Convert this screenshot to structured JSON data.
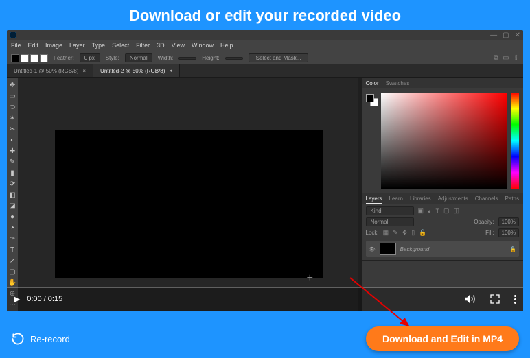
{
  "header": {
    "title": "Download or edit your recorded video"
  },
  "footer": {
    "rerecord_label": "Re-record",
    "download_label": "Download and Edit in MP4"
  },
  "video": {
    "current_time": "0:00",
    "duration": "0:15",
    "time_display": "0:00 / 0:15"
  },
  "ps": {
    "window_controls": [
      "—",
      "▢",
      "✕"
    ],
    "menu": [
      "File",
      "Edit",
      "Image",
      "Layer",
      "Type",
      "Select",
      "Filter",
      "3D",
      "View",
      "Window",
      "Help"
    ],
    "options": {
      "feather_label": "Feather:",
      "feather_value": "0 px",
      "style_label": "Style:",
      "style_value": "Normal",
      "width_label": "Width:",
      "height_label": "Height:",
      "select_mask": "Select and Mask..."
    },
    "tabs": [
      {
        "label": "Untitled-1 @ 50% (RGB/8)",
        "active": false
      },
      {
        "label": "Untitled-2 @ 50% (RGB/8)",
        "active": true
      }
    ],
    "color_panel": {
      "tabs": [
        "Color",
        "Swatches"
      ],
      "active": 0
    },
    "layers_panel": {
      "tabs": [
        "Layers",
        "Learn",
        "Libraries",
        "Adjustments",
        "Channels",
        "Paths"
      ],
      "active": 0,
      "filter_placeholder": "Kind",
      "blend_mode": "Normal",
      "opacity_label": "Opacity:",
      "opacity_value": "100%",
      "lock_label": "Lock:",
      "fill_label": "Fill:",
      "fill_value": "100%",
      "layer_name": "Background"
    },
    "tools": [
      "↖",
      "▭",
      "⊞",
      "✎",
      "◐",
      "◔",
      "✂",
      "⇄",
      "✏",
      "✑",
      "▮",
      "⟳",
      "◧",
      "⬒",
      "✥",
      "●",
      "◆",
      "T",
      "↗",
      "▢",
      "✋",
      "⊕",
      "⋯"
    ]
  }
}
